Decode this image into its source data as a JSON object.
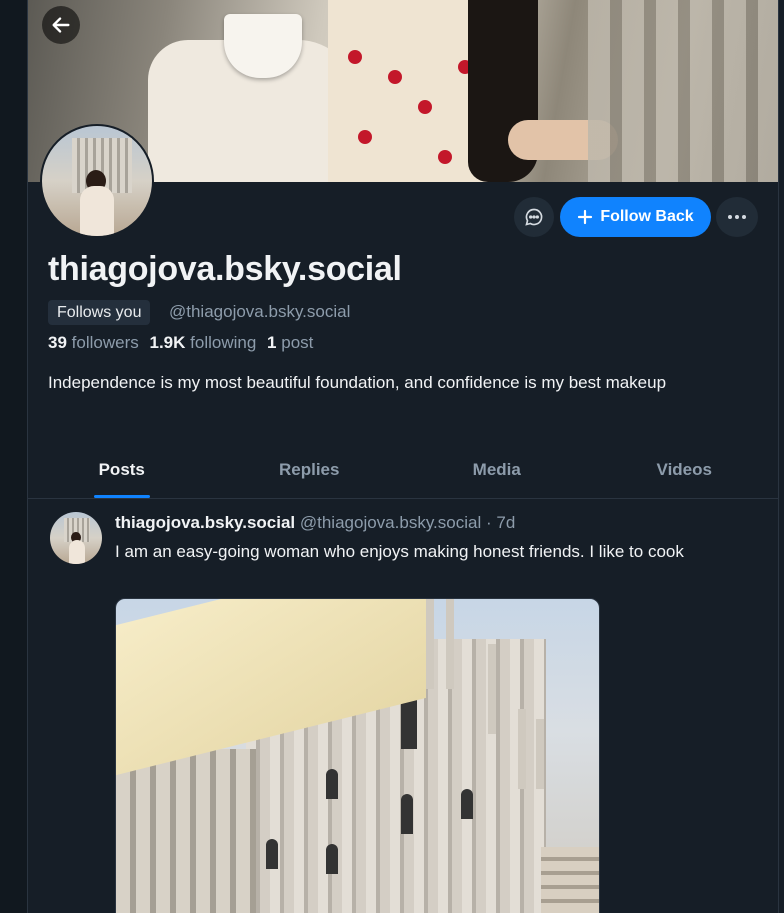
{
  "profile": {
    "display_name": "thiagojova.bsky.social",
    "follows_you_label": "Follows you",
    "handle": "@thiagojova.bsky.social",
    "followers_count": "39",
    "followers_label": "followers",
    "following_count": "1.9K",
    "following_label": "following",
    "posts_count": "1",
    "posts_label": "post",
    "bio": "Independence is my most beautiful foundation, and confidence is my best makeup"
  },
  "actions": {
    "follow_back_label": "Follow Back"
  },
  "tabs": [
    {
      "label": "Posts",
      "active": true
    },
    {
      "label": "Replies",
      "active": false
    },
    {
      "label": "Media",
      "active": false
    },
    {
      "label": "Videos",
      "active": false
    }
  ],
  "post": {
    "author": "thiagojova.bsky.social",
    "handle": "@thiagojova.bsky.social",
    "separator": "·",
    "time": "7d",
    "text": "I am an easy-going woman who enjoys making honest friends. I like to cook"
  },
  "icons": {
    "back": "arrow-left-icon",
    "message": "chat-bubble-icon",
    "follow": "plus-icon",
    "more": "ellipsis-icon"
  },
  "colors": {
    "background": "#161e27",
    "accent": "#1083fe",
    "muted_text": "#8d9cab",
    "button_bg": "#212c37"
  }
}
